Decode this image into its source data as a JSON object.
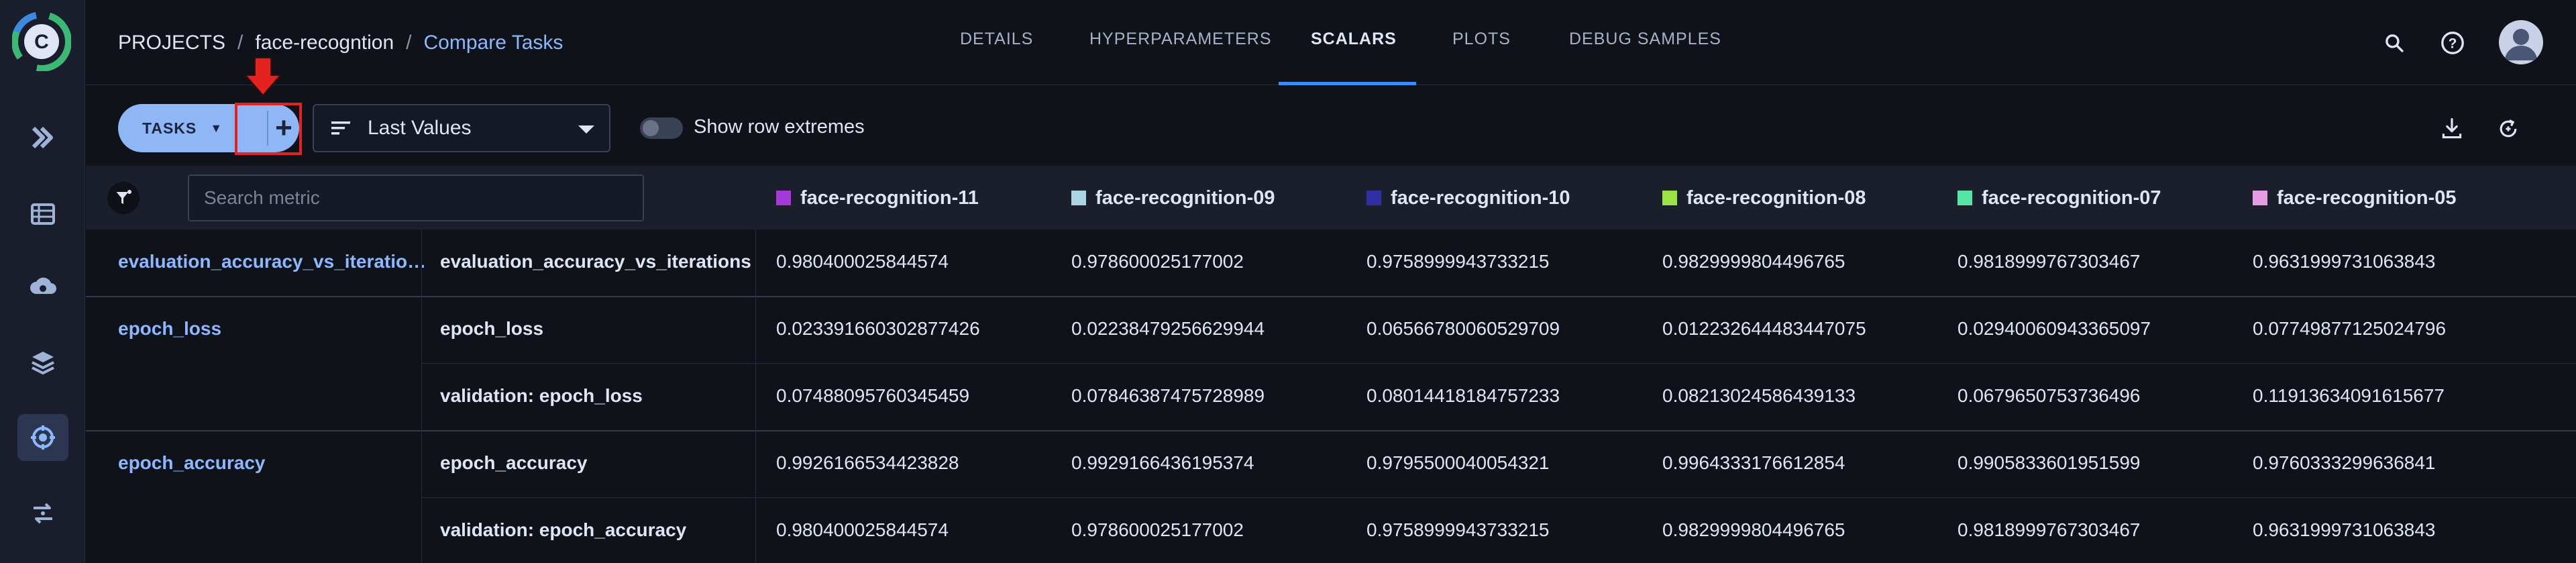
{
  "breadcrumb": {
    "root": "PROJECTS",
    "separator": "/",
    "project": "face-recogntion",
    "current": "Compare Tasks"
  },
  "tabs": [
    {
      "label": "DETAILS",
      "active": false
    },
    {
      "label": "HYPERPARAMETERS",
      "active": false
    },
    {
      "label": "SCALARS",
      "active": true
    },
    {
      "label": "PLOTS",
      "active": false
    },
    {
      "label": "DEBUG SAMPLES",
      "active": false
    }
  ],
  "toolbar": {
    "tasks_label": "TASKS",
    "add_label": "+",
    "value_mode": "Last Values",
    "toggle_label": "Show row extremes",
    "toggle_on": false
  },
  "table": {
    "search_placeholder": "Search metric",
    "columns": [
      {
        "name": "face-recognition-11",
        "color": "#a33ad8"
      },
      {
        "name": "face-recognition-09",
        "color": "#a8d4e4"
      },
      {
        "name": "face-recognition-10",
        "color": "#2f2fa3"
      },
      {
        "name": "face-recognition-08",
        "color": "#9be246"
      },
      {
        "name": "face-recognition-07",
        "color": "#55e4a6"
      },
      {
        "name": "face-recognition-05",
        "color": "#e59ce5"
      }
    ],
    "groups": [
      {
        "name": "evaluation_accuracy_vs_iteratio…",
        "rows": [
          {
            "metric": "evaluation_accuracy_vs_iterations",
            "values": [
              "0.980400025844574",
              "0.978600025177002",
              "0.9758999943733215",
              "0.9829999804496765",
              "0.9818999767303467",
              "0.9631999731063843"
            ]
          }
        ]
      },
      {
        "name": "epoch_loss",
        "rows": [
          {
            "metric": "epoch_loss",
            "values": [
              "0.023391660302877426",
              "0.02238479256629944",
              "0.06566780060529709",
              "0.012232644483447075",
              "0.02940060943365097",
              "0.07749877125024796"
            ]
          },
          {
            "metric": "validation: epoch_loss",
            "values": [
              "0.07488095760345459",
              "0.07846387475728989",
              "0.08014418184757233",
              "0.08213024586439133",
              "0.0679650753736496",
              "0.11913634091615677"
            ]
          }
        ]
      },
      {
        "name": "epoch_accuracy",
        "rows": [
          {
            "metric": "epoch_accuracy",
            "values": [
              "0.9926166534423828",
              "0.9929166436195374",
              "0.9795500040054321",
              "0.9964333176612854",
              "0.9905833601951599",
              "0.9760333299636841"
            ]
          },
          {
            "metric": "validation: epoch_accuracy",
            "values": [
              "0.980400025844574",
              "0.978600025177002",
              "0.9758999943733215",
              "0.9829999804496765",
              "0.9818999767303467",
              "0.9631999731063843"
            ]
          }
        ]
      }
    ]
  },
  "icons": {
    "logo": "clearml-logo",
    "search": "search-icon",
    "help": "help-icon",
    "avatar": "user-avatar-icon",
    "download": "download-icon",
    "refresh": "refresh-icon",
    "filter": "filter-icon",
    "select_icon": "sort-lines-icon"
  },
  "colors": {
    "accent": "#3d8bff",
    "link": "#8bb8ff",
    "tasks_pill": "#8fb7f5",
    "highlight": "#e52121"
  }
}
